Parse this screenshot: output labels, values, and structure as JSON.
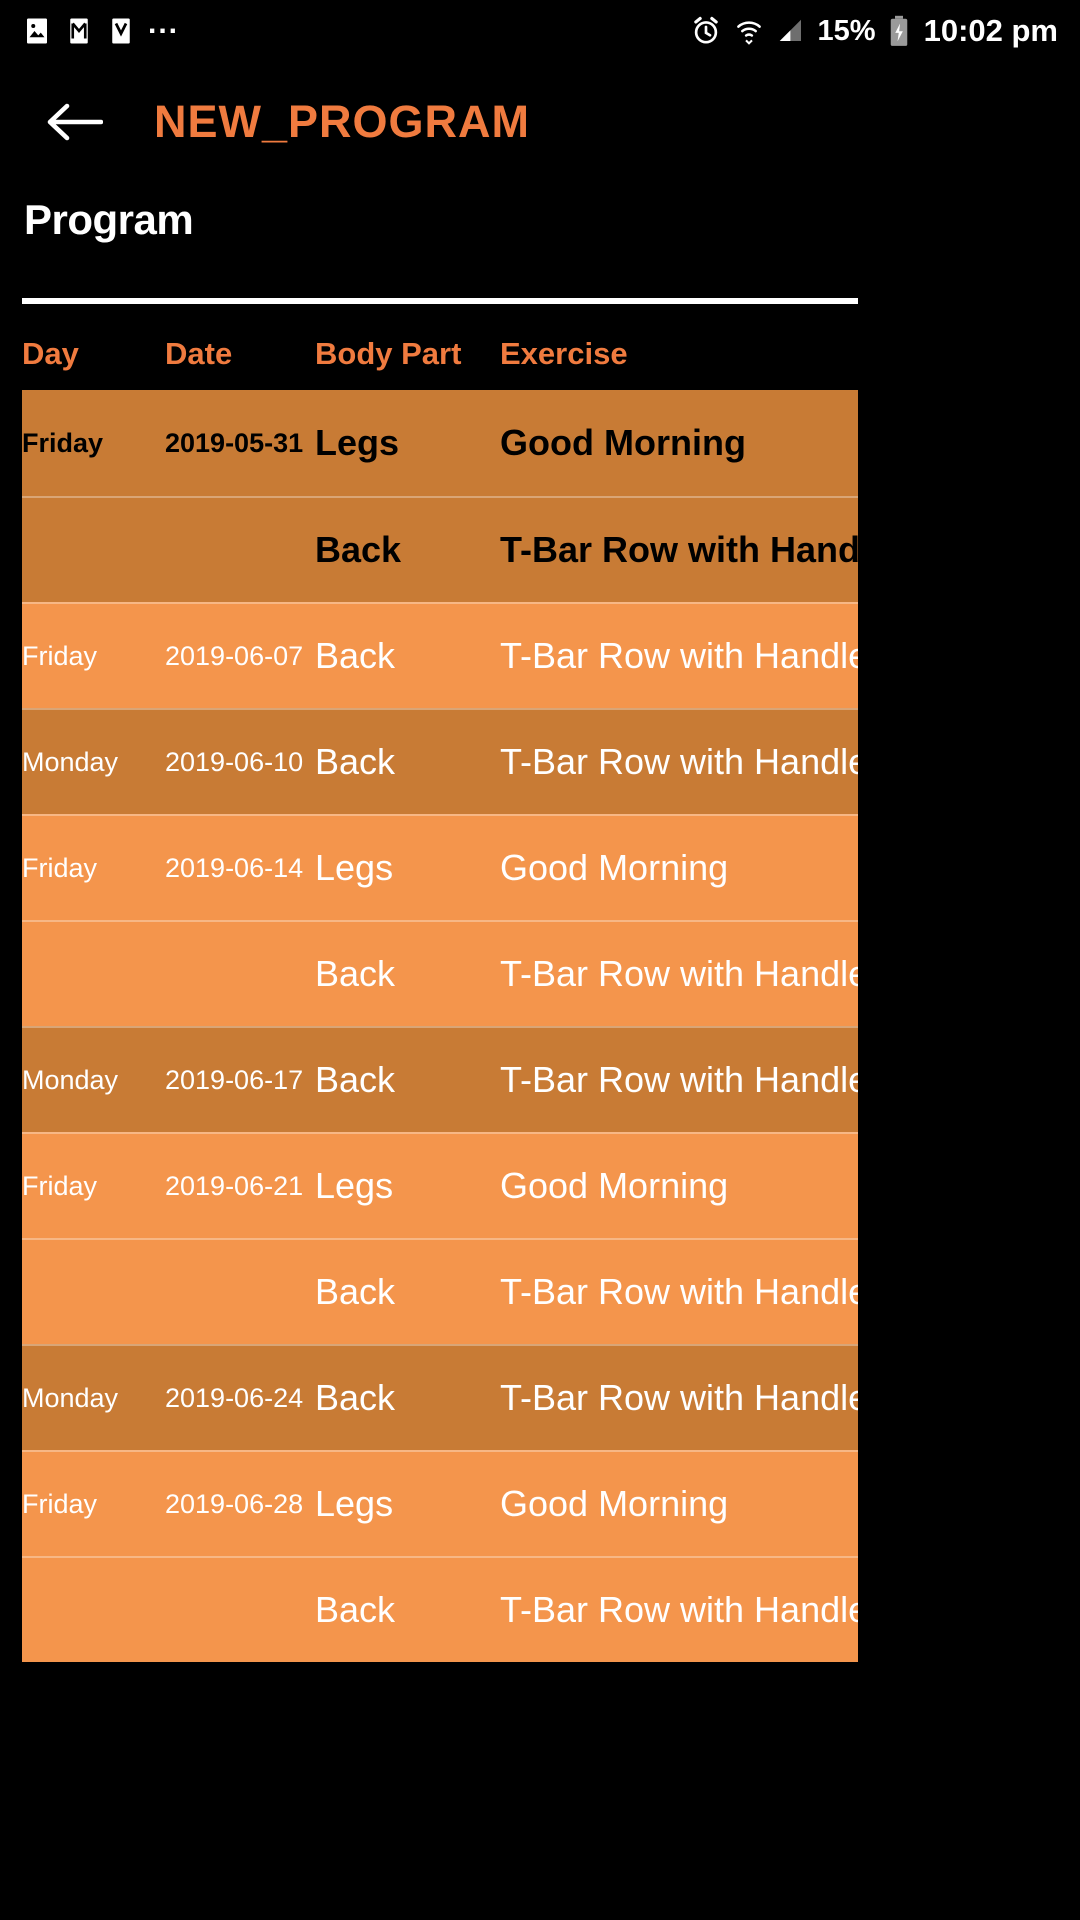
{
  "status_bar": {
    "left_icons": [
      "image-icon",
      "gmail-icon",
      "email-icon"
    ],
    "overflow": "...",
    "right_icons": [
      "alarm-icon",
      "wifi-icon",
      "signal-icon",
      "battery-charging-icon"
    ],
    "battery_text": "15%",
    "time": "10:02 pm"
  },
  "app_bar": {
    "back_icon": "back-arrow-icon",
    "title": "NEW_PROGRAM"
  },
  "section": {
    "title": "Program"
  },
  "table": {
    "headers": {
      "day": "Day",
      "date": "Date",
      "body_part": "Body Part",
      "exercise": "Exercise"
    },
    "rows": [
      {
        "day": "Friday",
        "date": "2019-05-31",
        "body_part": "Legs",
        "exercise": "Good Morning",
        "shade": "dark",
        "text": "black"
      },
      {
        "day": "",
        "date": "",
        "body_part": "Back",
        "exercise": "T-Bar Row with Handle",
        "shade": "dark",
        "text": "black"
      },
      {
        "day": "Friday",
        "date": "2019-06-07",
        "body_part": "Back",
        "exercise": "T-Bar Row with Handle",
        "shade": "light",
        "text": "white"
      },
      {
        "day": "Monday",
        "date": "2019-06-10",
        "body_part": "Back",
        "exercise": "T-Bar Row with Handle",
        "shade": "dark",
        "text": "white"
      },
      {
        "day": "Friday",
        "date": "2019-06-14",
        "body_part": "Legs",
        "exercise": "Good Morning",
        "shade": "light",
        "text": "white"
      },
      {
        "day": "",
        "date": "",
        "body_part": "Back",
        "exercise": "T-Bar Row with Handle",
        "shade": "light",
        "text": "white"
      },
      {
        "day": "Monday",
        "date": "2019-06-17",
        "body_part": "Back",
        "exercise": "T-Bar Row with Handle",
        "shade": "dark",
        "text": "white"
      },
      {
        "day": "Friday",
        "date": "2019-06-21",
        "body_part": "Legs",
        "exercise": "Good Morning",
        "shade": "light",
        "text": "white"
      },
      {
        "day": "",
        "date": "",
        "body_part": "Back",
        "exercise": "T-Bar Row with Handle",
        "shade": "light",
        "text": "white"
      },
      {
        "day": "Monday",
        "date": "2019-06-24",
        "body_part": "Back",
        "exercise": "T-Bar Row with Handle",
        "shade": "dark",
        "text": "white"
      },
      {
        "day": "Friday",
        "date": "2019-06-28",
        "body_part": "Legs",
        "exercise": "Good Morning",
        "shade": "light",
        "text": "white"
      },
      {
        "day": "",
        "date": "",
        "body_part": "Back",
        "exercise": "T-Bar Row with Handle",
        "shade": "light",
        "text": "white"
      }
    ]
  },
  "colors": {
    "accent": "#F07B3F",
    "row_dark": "#C87B35",
    "row_light": "#F4954C",
    "background": "#000000",
    "text_light": "#FFFFFF",
    "text_dark": "#000000"
  }
}
